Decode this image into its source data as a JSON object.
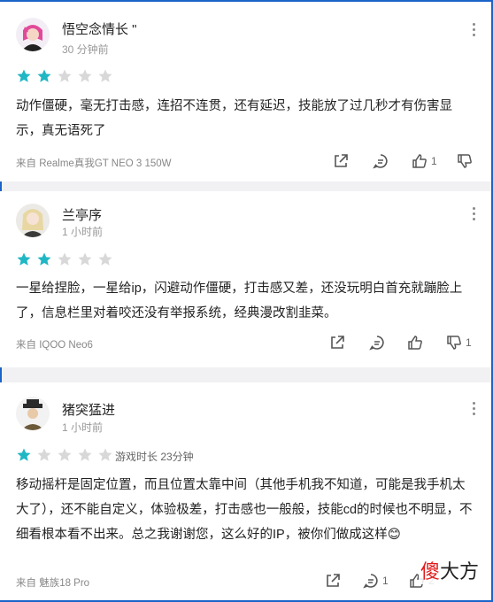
{
  "colors": {
    "star_on": "#20b7c4",
    "star_off": "#d8d8d8",
    "watermark_red": "#e21a1a",
    "frame": "#1a63c9"
  },
  "reviews": [
    {
      "username": "悟空念情长 \"",
      "time": "30 分钟前",
      "rating": 2,
      "playtime": "",
      "body": "动作僵硬，毫无打击感，连招不连贯，还有延迟，技能放了过几秒才有伤害显示，真无语死了",
      "device": "来自 Realme真我GT NEO 3 150W",
      "likes": "1",
      "avatar_icon": "pink-hair-avatar-icon"
    },
    {
      "username": "兰亭序",
      "time": "1 小时前",
      "rating": 2,
      "playtime": "",
      "body": "一星给捏脸，一星给ip，闪避动作僵硬，打击感又差，还没玩明白首充就蹦脸上了，信息栏里对着咬还没有举报系统，经典漫改割韭菜。",
      "device": "来自 IQOO Neo6",
      "likes": "1",
      "avatar_icon": "blonde-girl-avatar-icon"
    },
    {
      "username": "猪突猛进",
      "time": "1 小时前",
      "rating": 1,
      "playtime": "游戏时长 23分钟",
      "body": "移动摇杆是固定位置，而且位置太靠中间（其他手机我不知道，可能是我手机太大了），还不能自定义，体验极差，打击感也一般般，技能cd的时候也不明显，不细看根本看不出来。总之我谢谢您，这么好的IP，被你们做成这样😊",
      "device": "来自 魅族18 Pro",
      "comments": "1",
      "likes": "2",
      "avatar_icon": "hat-man-avatar-icon"
    }
  ],
  "watermark": {
    "red_char": "傻",
    "rest": "大方"
  }
}
